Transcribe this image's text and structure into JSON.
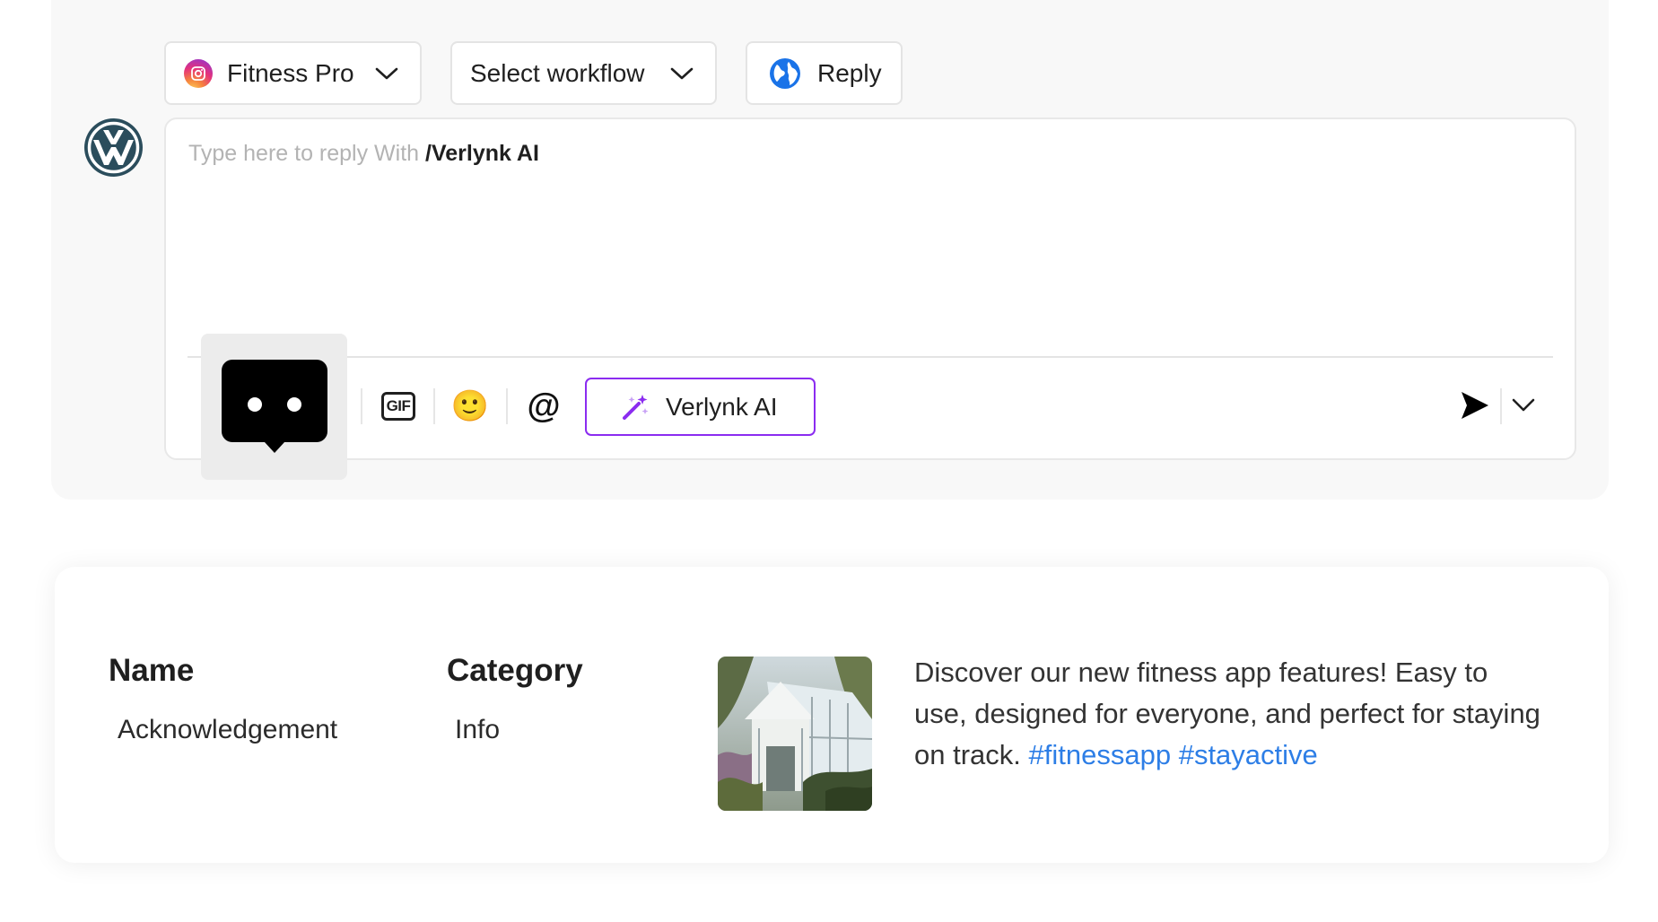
{
  "toolbar": {
    "account": {
      "label": "Fitness Pro",
      "icon": "instagram-icon"
    },
    "workflow": {
      "label": "Select workflow"
    },
    "reply": {
      "label": "Reply",
      "icon": "globe-icon"
    }
  },
  "editor": {
    "placeholder": "Type here to reply With ",
    "command": "/Verlynk AI",
    "ai_button_label": "Verlynk AI",
    "gif_label": "GIF",
    "mention_symbol": "@",
    "emoji": "🙂"
  },
  "template": {
    "headers": {
      "name": "Name",
      "category": "Category"
    },
    "values": {
      "name": "Acknowledgement",
      "category": "Info"
    },
    "caption": {
      "text": "Discover our new fitness app features! Easy to use, designed for everyone, and perfect for staying on track.",
      "hashtags": [
        "#fitnessapp",
        "#stayactive"
      ]
    }
  },
  "colors": {
    "accent": "#8b2cf0",
    "hashtag": "#2d7ee6",
    "globe": "#1a73e8"
  }
}
